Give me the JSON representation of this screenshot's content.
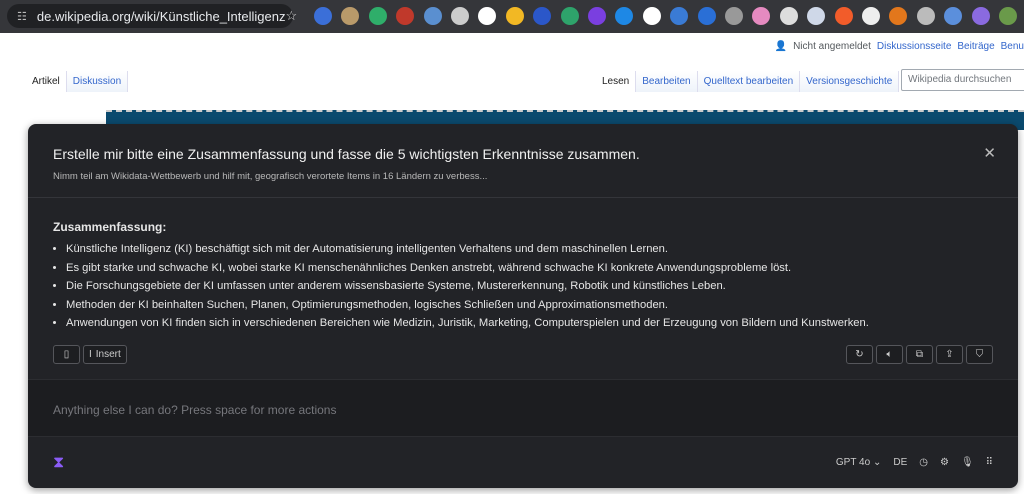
{
  "browser": {
    "url": "de.wikipedia.org/wiki/Künstliche_Intelligenz"
  },
  "wiki": {
    "user": {
      "status": "Nicht angemeldet",
      "links": [
        "Diskussionsseite",
        "Beiträge",
        "Benu"
      ]
    },
    "left_tabs": [
      "Artikel",
      "Diskussion"
    ],
    "right_tabs": [
      "Lesen",
      "Bearbeiten",
      "Quelltext bearbeiten",
      "Versionsgeschichte"
    ],
    "search_placeholder": "Wikipedia durchsuchen"
  },
  "assistant": {
    "prompt": "Erstelle mir bitte eine Zusammenfassung und fasse die 5 wichtigsten Erkenntnisse zusammen.",
    "context": "Nimm teil am Wikidata-Wettbewerb und hilf mit, geografisch verortete Items in 16 Ländern zu verbess...",
    "heading": "Zusammenfassung:",
    "bullets": [
      "Künstliche Intelligenz (KI) beschäftigt sich mit der Automatisierung intelligenten Verhaltens und dem maschinellen Lernen.",
      "Es gibt starke und schwache KI, wobei starke KI menschenähnliches Denken anstrebt, während schwache KI konkrete Anwendungsprobleme löst.",
      "Die Forschungsgebiete der KI umfassen unter anderem wissensbasierte Systeme, Mustererkennung, Robotik und künstliches Leben.",
      "Methoden der KI beinhalten Suchen, Planen, Optimierungsmethoden, logisches Schließen und Approximationsmethoden.",
      "Anwendungen von KI finden sich in verschiedenen Bereichen wie Medizin, Juristik, Marketing, Computerspielen und der Erzeugung von Bildern und Kunstwerken."
    ],
    "insert_label": "Insert",
    "input_placeholder": "Anything else I can do? Press space for more actions",
    "model": "GPT 4o",
    "language": "DE",
    "accent": "#8b5cf6"
  }
}
